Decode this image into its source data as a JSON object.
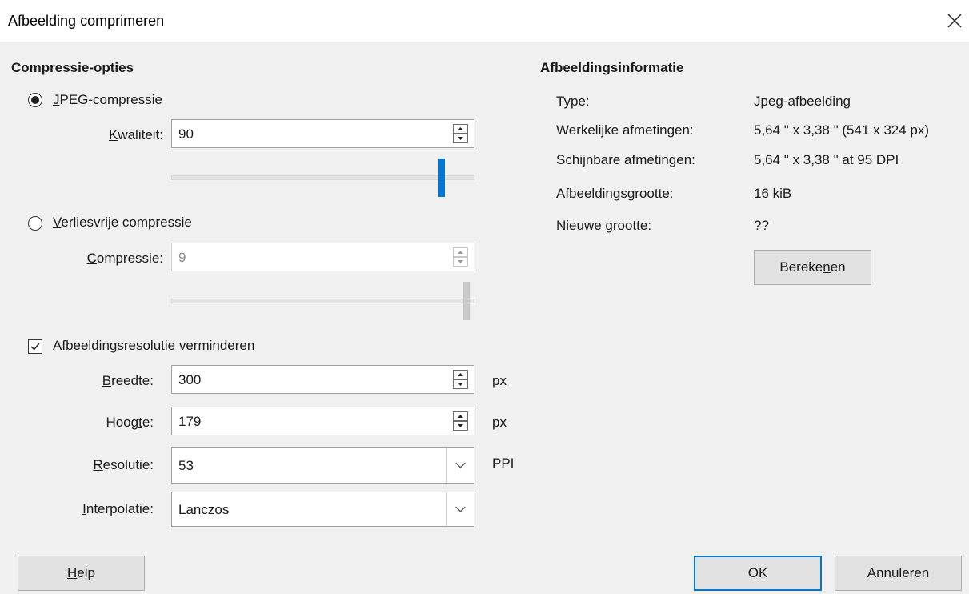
{
  "window": {
    "title": "Afbeelding comprimeren",
    "close_icon": "close-icon"
  },
  "compression": {
    "heading": "Compressie-opties",
    "jpeg": {
      "label_mnemonic": "J",
      "label_rest": "PEG-compressie",
      "selected": true,
      "quality_label_mnemonic": "K",
      "quality_label_rest": "waliteit:",
      "quality_value": "90",
      "slider_level_percent": 90
    },
    "lossless": {
      "label_mnemonic": "V",
      "label_rest": "erliesvrije compressie",
      "selected": false,
      "compression_label_mnemonic": "C",
      "compression_label_rest": "ompressie:",
      "compression_value": "9",
      "slider_level_value": 9,
      "slider_max": 9
    }
  },
  "resize": {
    "checkbox_label_mnemonic": "A",
    "checkbox_label_rest": "fbeeldingsresolutie verminderen",
    "checked": true,
    "width_label_mnemonic": "B",
    "width_label_rest": "reedte:",
    "width_value": "300",
    "width_unit": "px",
    "height_label_pre": "Hoog",
    "height_label_mnemonic": "t",
    "height_label_post": "e:",
    "height_value": "179",
    "height_unit": "px",
    "resolution_label_mnemonic": "R",
    "resolution_label_rest": "esolutie:",
    "resolution_value": "53",
    "resolution_unit": "PPI",
    "interpolation_label_mnemonic": "I",
    "interpolation_label_rest": "nterpolatie:",
    "interpolation_value": "Lanczos"
  },
  "info": {
    "heading": "Afbeeldingsinformatie",
    "rows": [
      {
        "label": "Type:",
        "value": "Jpeg-afbeelding"
      },
      {
        "label": "Werkelijke afmetingen:",
        "value": "5,64 \" x 3,38 \" (541 x 324 px)"
      },
      {
        "label": "Schijnbare afmetingen:",
        "value": "5,64 \" x 3,38 \" at 95 DPI"
      },
      {
        "label": "Afbeeldingsgrootte:",
        "value": "16 kiB"
      },
      {
        "label": "Nieuwe grootte:",
        "value": "??"
      }
    ],
    "calculate_pre": "Bereke",
    "calculate_mnemonic": "n",
    "calculate_post": "en"
  },
  "buttons": {
    "help_mnemonic": "H",
    "help_rest": "elp",
    "ok": "OK",
    "cancel": "Annuleren"
  },
  "colors": {
    "accent": "#0078d7",
    "slider_disabled": "#c8c8c8"
  }
}
